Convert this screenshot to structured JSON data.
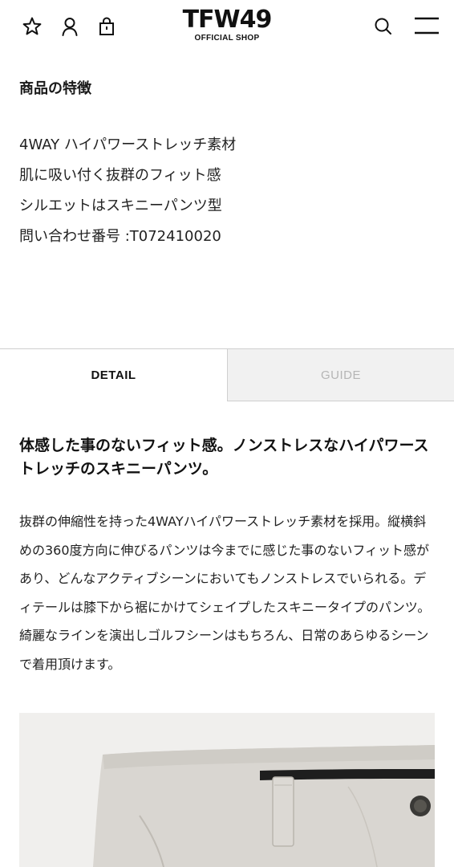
{
  "header": {
    "logo_main": "TFW49",
    "logo_sub": "OFFICIAL SHOP",
    "icons": [
      "star-icon",
      "user-icon",
      "shopping-bag-icon",
      "search-icon",
      "menu-icon"
    ]
  },
  "features": {
    "heading": "商品の特徴",
    "items": [
      "4WAY ハイパワーストレッチ素材",
      "肌に吸い付く抜群のフィット感",
      "シルエットはスキニーパンツ型",
      "問い合わせ番号 :T072410020"
    ]
  },
  "tabs": {
    "detail": "DETAIL",
    "guide": "GUIDE",
    "active": "detail"
  },
  "detail": {
    "headline": "体感した事のないフィット感。ノンストレスなハイパワーストレッチのスキニーパンツ。",
    "body": "抜群の伸縮性を持った4WAYハイパワーストレッチ素材を採用。縦横斜めの360度方向に伸びるパンツは今までに感じた事のないフィット感があり、どんなアクティブシーンにおいてもノンストレスでいられる。ディテールは膝下から裾にかけてシェイプしたスキニータイプのパンツ。綺麗なラインを演出しゴルフシーンはもちろん、日常のあらゆるシーンで着用頂けます。"
  },
  "product_image": {
    "subject": "light grey pants waistband close-up"
  },
  "colors": {
    "background": "#ffffff",
    "text": "#1a1a1a",
    "tab_inactive_bg": "#f1f1f1",
    "tab_inactive_text": "#b5b5b5",
    "border": "#cfcfcf",
    "image_bg": "#f0efed",
    "fabric": "#d9d6d1"
  }
}
